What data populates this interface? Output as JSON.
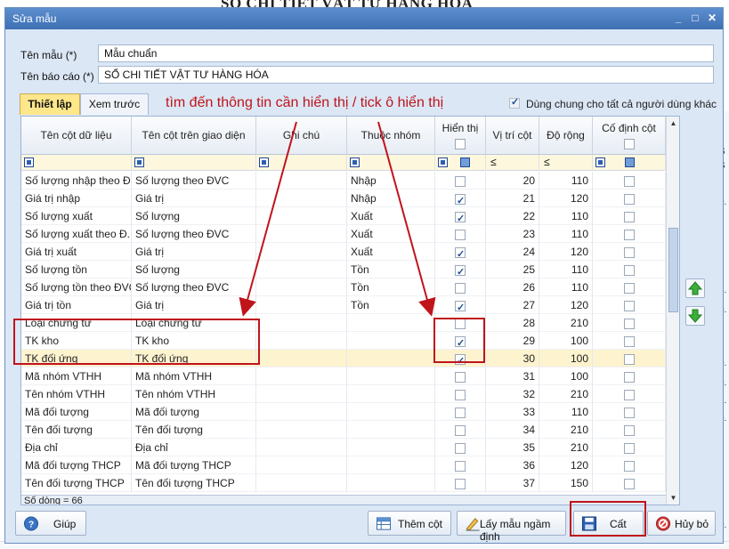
{
  "background": {
    "title": "SỔ CHI TIẾT VẬT TƯ HÀNG HÓA",
    "right_edge_values": [
      "S",
      "S",
      "0.",
      "6.",
      "0.",
      "0.",
      "0.",
      "7.",
      "0.",
      "0."
    ]
  },
  "window": {
    "title": "Sửa mẫu",
    "minimize_label": "_",
    "maximize_label": "□",
    "close_label": "✕"
  },
  "form": {
    "template_name_label": "Tên mẫu (*)",
    "template_name_value": "Mẫu chuẩn",
    "report_name_label": "Tên báo cáo (*)",
    "report_name_value": "SỔ CHI TIẾT VẬT TƯ HÀNG HÓA"
  },
  "tabs": [
    {
      "label": "Thiết lập",
      "active": true
    },
    {
      "label": "Xem trước",
      "active": false
    }
  ],
  "annotation": "tìm đến thông tin cần hiển thị / tick ô hiển thị",
  "shared_label": "Dùng chung cho tất cả người dùng khác",
  "shared_checked": true,
  "grid": {
    "columns": {
      "data_col": "Tên cột dữ liệu",
      "ui_col": "Tên cột trên giao diện",
      "note": "Ghi chú",
      "group": "Thuộc nhóm",
      "visible": "Hiển thị",
      "position": "Vị trí cột",
      "width": "Độ rộng",
      "freeze": "Cố định cột"
    },
    "filter_op": "≤",
    "rows": [
      {
        "data": "Số lượng nhập theo Đ...",
        "ui": "Số lượng theo ĐVC",
        "note": "",
        "group": "Nhập",
        "visible": false,
        "pos": "20",
        "width": "110",
        "freeze": false
      },
      {
        "data": "Giá trị nhập",
        "ui": "Giá trị",
        "note": "",
        "group": "Nhập",
        "visible": true,
        "pos": "21",
        "width": "120",
        "freeze": false
      },
      {
        "data": "Số lượng xuất",
        "ui": "Số lượng",
        "note": "",
        "group": "Xuất",
        "visible": true,
        "pos": "22",
        "width": "110",
        "freeze": false
      },
      {
        "data": "Số lượng xuất theo Đ...",
        "ui": "Số lượng theo ĐVC",
        "note": "",
        "group": "Xuất",
        "visible": false,
        "pos": "23",
        "width": "110",
        "freeze": false
      },
      {
        "data": "Giá trị xuất",
        "ui": "Giá trị",
        "note": "",
        "group": "Xuất",
        "visible": true,
        "pos": "24",
        "width": "120",
        "freeze": false
      },
      {
        "data": "Số lượng tồn",
        "ui": "Số lượng",
        "note": "",
        "group": "Tồn",
        "visible": true,
        "pos": "25",
        "width": "110",
        "freeze": false
      },
      {
        "data": "Số lượng tồn theo ĐVC",
        "ui": "Số lượng theo ĐVC",
        "note": "",
        "group": "Tồn",
        "visible": false,
        "pos": "26",
        "width": "110",
        "freeze": false
      },
      {
        "data": "Giá trị tồn",
        "ui": "Giá trị",
        "note": "",
        "group": "Tồn",
        "visible": true,
        "pos": "27",
        "width": "120",
        "freeze": false
      },
      {
        "data": "Loại chứng từ",
        "ui": "Loại chứng từ",
        "note": "",
        "group": "",
        "visible": false,
        "pos": "28",
        "width": "210",
        "freeze": false
      },
      {
        "data": "TK kho",
        "ui": "TK kho",
        "note": "",
        "group": "",
        "visible": true,
        "pos": "29",
        "width": "100",
        "freeze": false
      },
      {
        "data": "TK đối ứng",
        "ui": "TK đối ứng",
        "note": "",
        "group": "",
        "visible": true,
        "pos": "30",
        "width": "100",
        "freeze": false
      },
      {
        "data": "Mã nhóm VTHH",
        "ui": "Mã nhóm VTHH",
        "note": "",
        "group": "",
        "visible": false,
        "pos": "31",
        "width": "100",
        "freeze": false
      },
      {
        "data": "Tên nhóm VTHH",
        "ui": "Tên nhóm VTHH",
        "note": "",
        "group": "",
        "visible": false,
        "pos": "32",
        "width": "210",
        "freeze": false
      },
      {
        "data": "Mã đối tượng",
        "ui": "Mã đối tượng",
        "note": "",
        "group": "",
        "visible": false,
        "pos": "33",
        "width": "110",
        "freeze": false
      },
      {
        "data": "Tên đối tượng",
        "ui": "Tên đối tượng",
        "note": "",
        "group": "",
        "visible": false,
        "pos": "34",
        "width": "210",
        "freeze": false
      },
      {
        "data": "Địa chỉ",
        "ui": "Địa chỉ",
        "note": "",
        "group": "",
        "visible": false,
        "pos": "35",
        "width": "210",
        "freeze": false
      },
      {
        "data": "Mã đối tượng THCP",
        "ui": "Mã đối tượng THCP",
        "note": "",
        "group": "",
        "visible": false,
        "pos": "36",
        "width": "120",
        "freeze": false
      },
      {
        "data": "Tên đối tượng THCP",
        "ui": "Tên đối tượng THCP",
        "note": "",
        "group": "",
        "visible": false,
        "pos": "37",
        "width": "150",
        "freeze": false
      }
    ],
    "selected_row": 10,
    "row_count": "Số dòng = 66"
  },
  "buttons": {
    "help": "Giúp",
    "add_column": "Thêm cột",
    "default_template": "Lấy mẫu ngầm định",
    "save": "Cất",
    "cancel": "Hủy bỏ"
  },
  "colors": {
    "annotation_red": "#c0141b",
    "active_tab": "#fde78a",
    "titlebar": "#4a7cc0"
  }
}
